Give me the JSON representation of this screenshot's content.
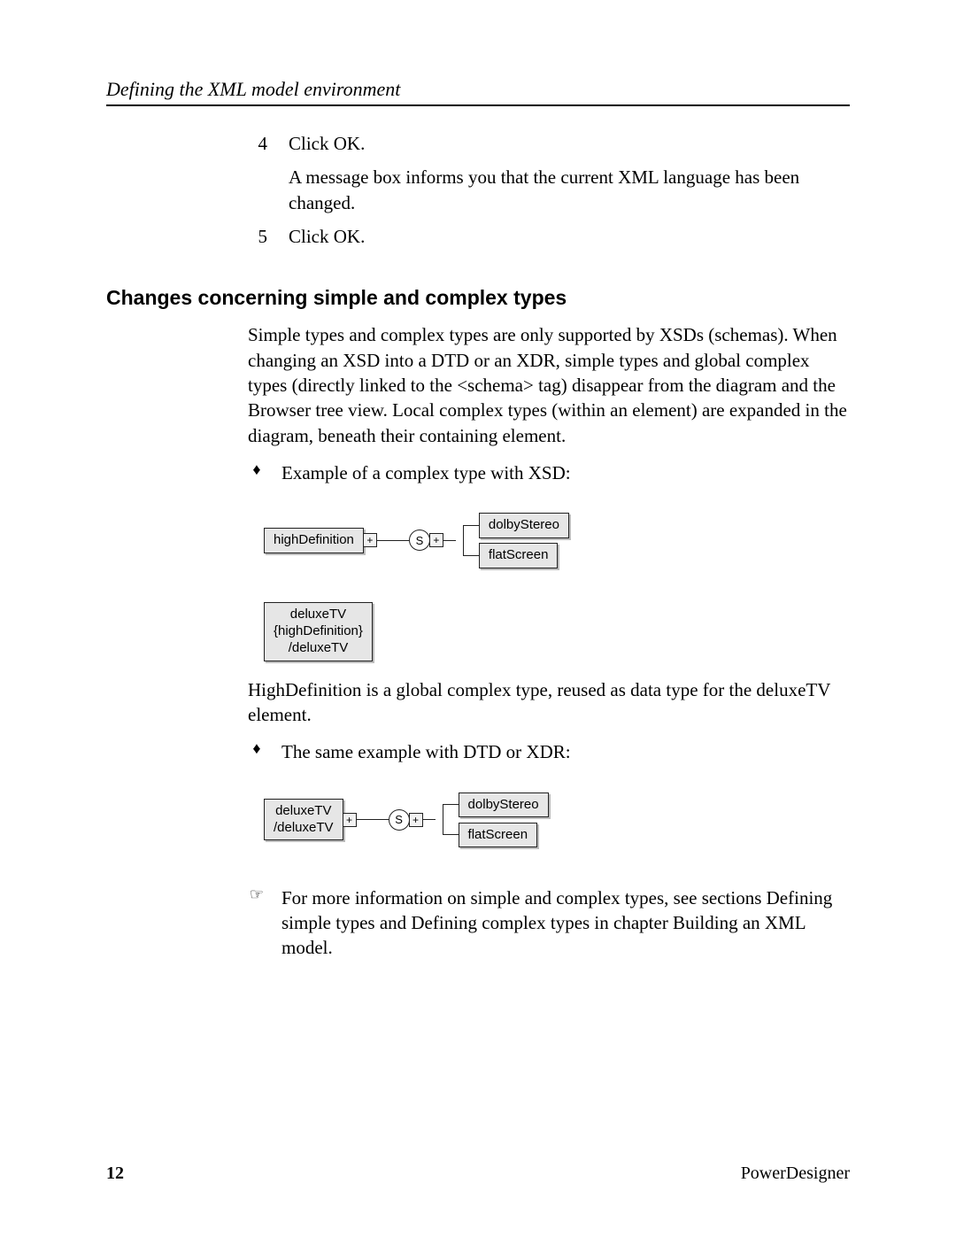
{
  "header": {
    "running_title": "Defining the XML model environment"
  },
  "steps": {
    "items": [
      {
        "num": "4",
        "text": "Click OK.",
        "extra": "A message box informs you that the current XML language has been changed."
      },
      {
        "num": "5",
        "text": "Click OK."
      }
    ]
  },
  "section": {
    "heading": "Changes concerning simple and complex types",
    "intro": "Simple types and complex types are only supported by XSDs (schemas). When changing an XSD into a DTD or an XDR, simple types and global complex types (directly linked to the <schema> tag) disappear from the diagram and the Browser tree view. Local complex types (within an element) are expanded in the diagram, beneath their containing element."
  },
  "bullets": {
    "items": [
      {
        "text": "Example of a complex type with XSD:"
      },
      {
        "text": "The same example with DTD or XDR:"
      }
    ]
  },
  "diagram1": {
    "root": "highDefinition",
    "seq_label": "S",
    "children": [
      "dolbyStereo",
      "flatScreen"
    ],
    "extra_box_lines": [
      "deluxeTV",
      "{highDefinition}",
      "/deluxeTV"
    ]
  },
  "diagram2": {
    "root_lines": [
      "deluxeTV",
      "/deluxeTV"
    ],
    "seq_label": "S",
    "children": [
      "dolbyStereo",
      "flatScreen"
    ]
  },
  "after_d1": "HighDefinition is a global complex type, reused as data type for the deluxeTV element.",
  "see_also": {
    "text": "For more information on simple and complex types, see sections Defining simple types and Defining complex types in chapter Building an XML model."
  },
  "footer": {
    "page": "12",
    "brand": "PowerDesigner"
  }
}
